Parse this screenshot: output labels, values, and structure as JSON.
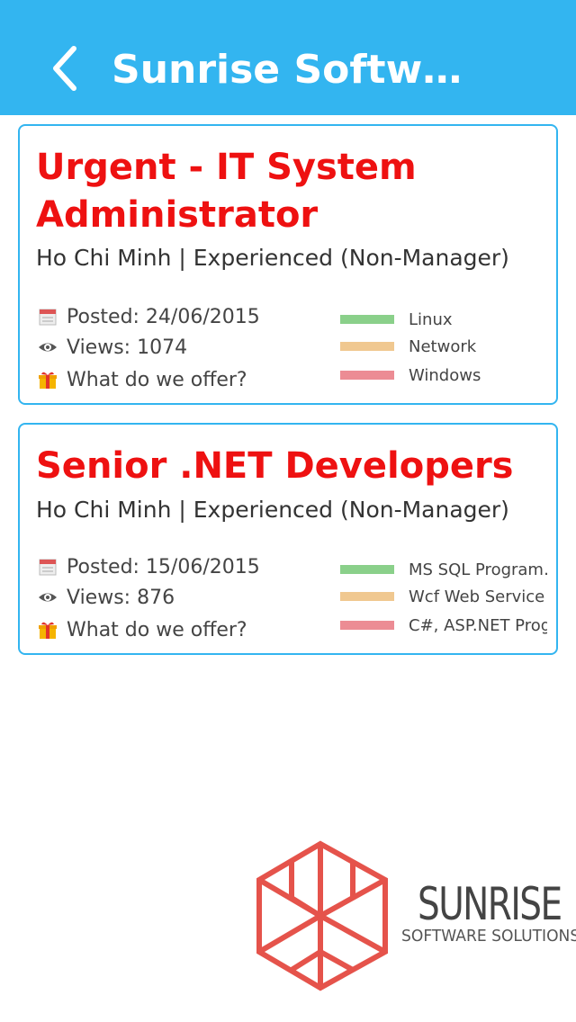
{
  "app_bar": {
    "title": "Sunrise Softwar…",
    "background_color": "#33b5f0",
    "back_icon": "chevron-left-icon"
  },
  "jobs": [
    {
      "title": "Urgent - IT System Administrator",
      "location_level": "Ho Chi Minh | Experienced (Non-Manager)",
      "posted": "Posted: 24/06/2015",
      "views": "Views: 1074",
      "offer": "What do we offer?",
      "skills": [
        {
          "label": "Linux",
          "color": "#8ad08a"
        },
        {
          "label": "Network",
          "color": "#f0c890"
        },
        {
          "label": "Windows",
          "color": "#ec8c94"
        }
      ]
    },
    {
      "title": "Senior .NET Developers",
      "location_level": "Ho Chi Minh | Experienced (Non-Manager)",
      "posted": "Posted: 15/06/2015",
      "views": "Views: 876",
      "offer": "What do we offer?",
      "skills": [
        {
          "label": "MS SQL Program…",
          "color": "#8ad08a"
        },
        {
          "label": "Wcf Web Service",
          "color": "#f0c890"
        },
        {
          "label": "C#, ASP.NET Prog…",
          "color": "#ec8c94"
        }
      ]
    }
  ],
  "icons": {
    "posted": "calendar-icon",
    "views": "eye-icon",
    "offer": "gift-icon"
  },
  "colors": {
    "title_red": "#ee1111",
    "card_border": "#33b5f0",
    "logo_red": "#e5534b"
  },
  "logo": {
    "name": "SUNRISE",
    "tagline": "SOFTWARE SOLUTIONS"
  }
}
